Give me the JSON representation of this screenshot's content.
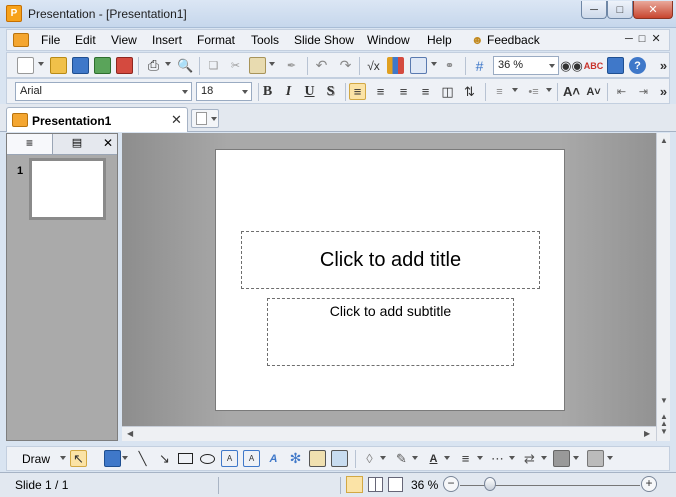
{
  "window": {
    "title": "Presentation - [Presentation1]"
  },
  "menu": {
    "items": [
      "File",
      "Edit",
      "View",
      "Insert",
      "Format",
      "Tools",
      "Slide Show",
      "Window",
      "Help",
      "Feedback"
    ]
  },
  "toolbar2": {
    "font_name": "Arial",
    "font_size": "18",
    "bold_label": "B",
    "italic_label": "I",
    "underline_label": "U",
    "shadow_label": "S"
  },
  "toolbar1": {
    "zoom": "36 %"
  },
  "tabs": {
    "document": "Presentation1"
  },
  "slide_pane": {
    "slide_number": "1"
  },
  "slide": {
    "title_placeholder": "Click to add title",
    "subtitle_placeholder": "Click to add subtitle"
  },
  "drawbar": {
    "draw_label": "Draw"
  },
  "status": {
    "slide_counter": "Slide 1 / 1",
    "zoom": "36 %"
  },
  "colors": {
    "accent": "#f7a21b",
    "close_red": "#c8452f",
    "canvas_gray": "#a9a9a9"
  }
}
